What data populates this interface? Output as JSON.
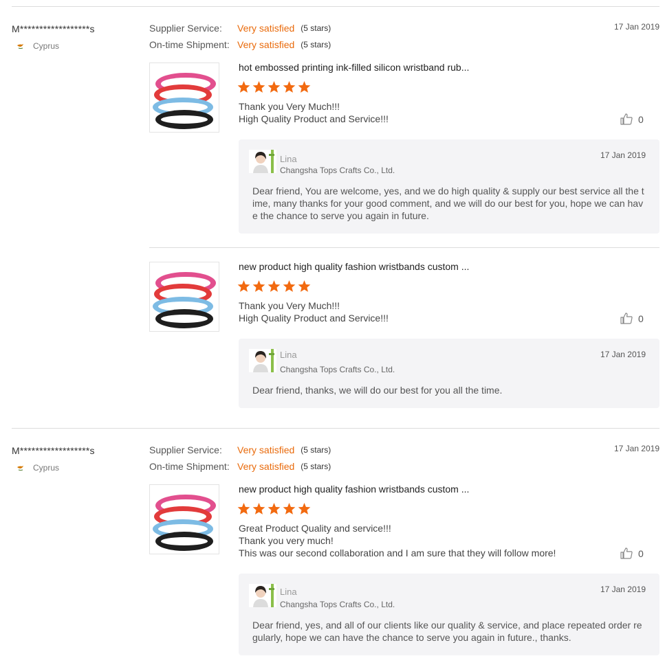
{
  "colors": {
    "accent": "#e96a0b",
    "star": "#f26a10",
    "reply_bg": "#f4f4f6"
  },
  "reviews": [
    {
      "buyer": "M******************s",
      "country": "Cyprus",
      "supplier_label": "Supplier Service:",
      "supplier_value": "Very satisfied",
      "supplier_stars": "(5 stars)",
      "shipment_label": "On-time Shipment:",
      "shipment_value": "Very satisfied",
      "shipment_stars": "(5 stars)",
      "date": "17 Jan 2019",
      "items": [
        {
          "title": "hot embossed printing ink-filled silicon wristband rub...",
          "rating": 5,
          "text": "Thank you Very Much!!!\nHigh Quality Product and Service!!!",
          "likes": "0",
          "reply": {
            "name": "Lina",
            "company": "Changsha Tops Crafts Co., Ltd.",
            "date": "17 Jan 2019",
            "text": "Dear friend, You are welcome, yes, and we do high quality & supply our best service all the time, many thanks for your good comment, and we will do our best for you, hope we can have the chance to serve you again in future."
          }
        },
        {
          "title": "new product high quality fashion wristbands custom ...",
          "rating": 5,
          "text": "Thank you Very Much!!!\nHigh Quality Product and Service!!!",
          "likes": "0",
          "reply": {
            "name": "Lina",
            "company": "Changsha Tops Crafts Co., Ltd.",
            "date": "17 Jan 2019",
            "text": "Dear friend,  thanks, we will do our best for you all the time."
          }
        }
      ]
    },
    {
      "buyer": "M******************s",
      "country": "Cyprus",
      "supplier_label": "Supplier Service:",
      "supplier_value": "Very satisfied",
      "supplier_stars": "(5 stars)",
      "shipment_label": "On-time Shipment:",
      "shipment_value": "Very satisfied",
      "shipment_stars": "(5 stars)",
      "date": "17 Jan 2019",
      "items": [
        {
          "title": "new product high quality fashion wristbands custom ...",
          "rating": 5,
          "text": "Great Product Quality and service!!!\nThank you very much!\nThis was our second collaboration and I am sure that they will follow more!",
          "likes": "0",
          "reply": {
            "name": "Lina",
            "company": "Changsha Tops Crafts Co., Ltd.",
            "date": "17 Jan 2019",
            "text": "Dear friend,  yes, and all of our clients like our quality & service, and place repeated order regularly, hope we can have the chance to serve you again in future., thanks."
          }
        }
      ]
    }
  ]
}
